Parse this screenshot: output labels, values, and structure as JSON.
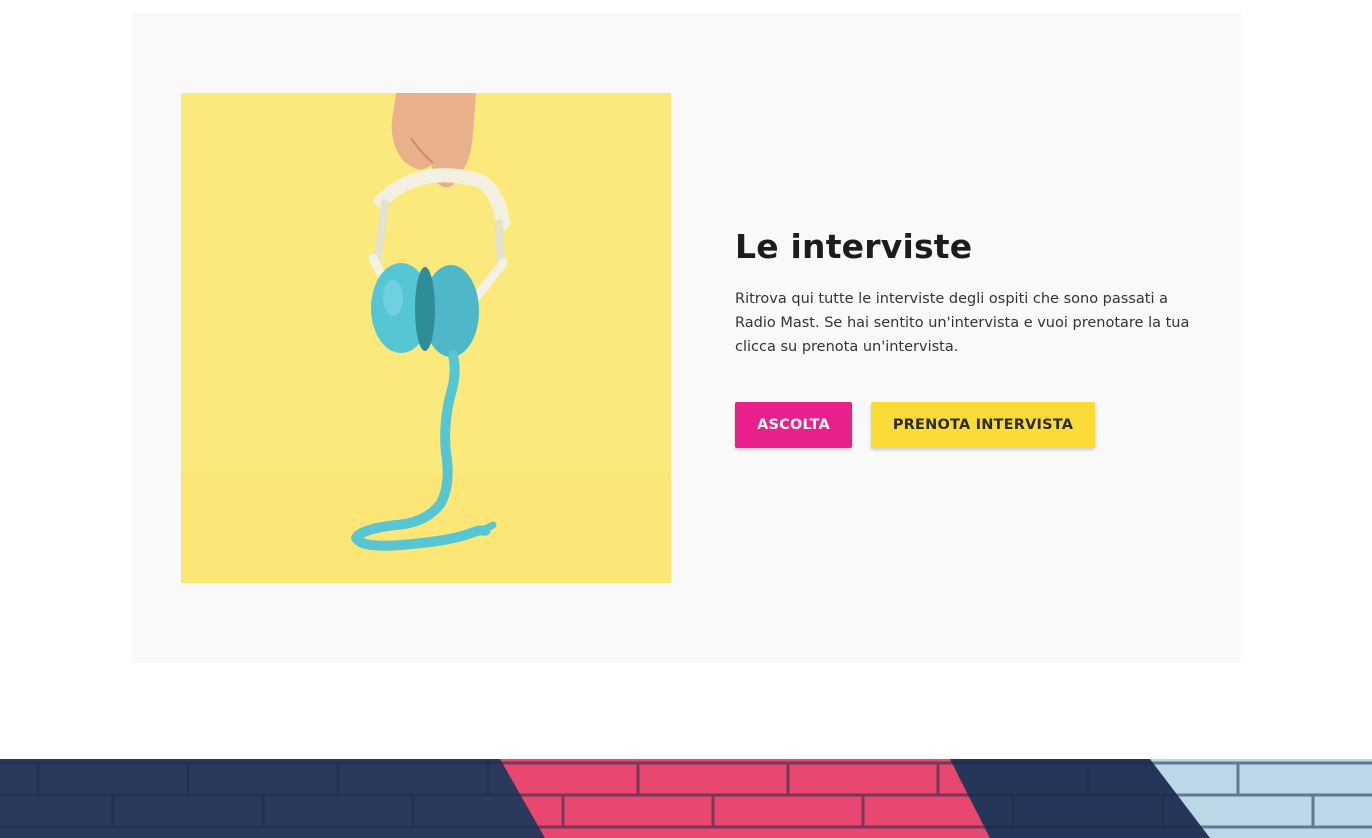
{
  "section": {
    "title": "Le interviste",
    "description": "Ritrova qui tutte le interviste degli ospiti che sono passati a Radio Mast. Se hai sentito un'intervista e vuoi prenotare la tua clicca su prenota un'intervista.",
    "buttons": {
      "listen_label": "ASCOLTA",
      "book_label": "PRENOTA INTERVISTA"
    },
    "image": {
      "subject": "hand-holding-headphones-image"
    }
  },
  "colors": {
    "card_bg": "#f9f9f9",
    "photo_bg": "#fce97c",
    "headphones": "#56c5d4",
    "listen_button": "#e91f8c",
    "book_button": "#fbdb35",
    "banner_navy": "#2b3a5c",
    "banner_pink": "#e8476f",
    "banner_light_blue": "#bcd7e6"
  }
}
